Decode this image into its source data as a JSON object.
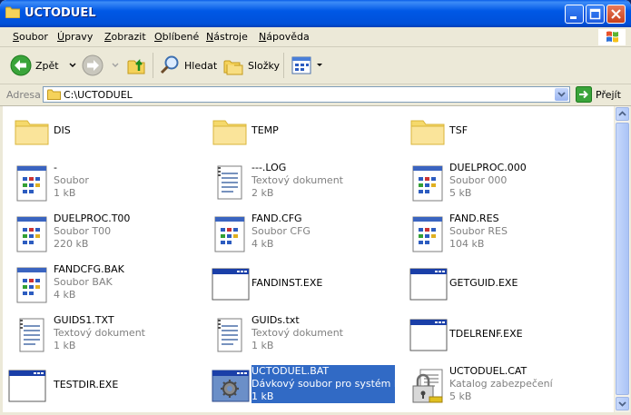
{
  "window": {
    "title": "UCTODUEL"
  },
  "menu": [
    {
      "key": "S",
      "rest": "oubor"
    },
    {
      "key": "Ú",
      "rest": "pravy"
    },
    {
      "key": "Z",
      "rest": "obrazit"
    },
    {
      "key": "O",
      "rest": "blíbené"
    },
    {
      "key": "N",
      "rest": "ástroje"
    },
    {
      "key": "N",
      "rest": "ápověda"
    }
  ],
  "toolbar": {
    "back_label": "Zpět",
    "search_label": "Hledat",
    "folders_label": "Složky"
  },
  "address": {
    "label": "Adresa",
    "path": "C:\\UCTODUEL",
    "go_label": "Přejít"
  },
  "items": [
    {
      "kind": "folder",
      "name": "DIS",
      "type": "",
      "size": ""
    },
    {
      "kind": "folder",
      "name": "TEMP",
      "type": "",
      "size": ""
    },
    {
      "kind": "folder",
      "name": "TSF",
      "type": "",
      "size": ""
    },
    {
      "kind": "file",
      "name": "-",
      "type": "Soubor",
      "size": "1 kB"
    },
    {
      "kind": "text",
      "name": "---.LOG",
      "type": "Textový dokument",
      "size": "2 kB"
    },
    {
      "kind": "file",
      "name": "DUELPROC.000",
      "type": "Soubor 000",
      "size": "5 kB"
    },
    {
      "kind": "file",
      "name": "DUELPROC.T00",
      "type": "Soubor T00",
      "size": "220 kB"
    },
    {
      "kind": "file",
      "name": "FAND.CFG",
      "type": "Soubor CFG",
      "size": "4 kB"
    },
    {
      "kind": "file",
      "name": "FAND.RES",
      "type": "Soubor RES",
      "size": "104 kB"
    },
    {
      "kind": "file",
      "name": "FANDCFG.BAK",
      "type": "Soubor BAK",
      "size": "4 kB"
    },
    {
      "kind": "exe",
      "name": "FANDINST.EXE",
      "type": "",
      "size": ""
    },
    {
      "kind": "exe",
      "name": "GETGUID.EXE",
      "type": "",
      "size": ""
    },
    {
      "kind": "text",
      "name": "GUIDS1.TXT",
      "type": "Textový dokument",
      "size": "1 kB"
    },
    {
      "kind": "text",
      "name": "GUIDs.txt",
      "type": "Textový dokument",
      "size": "1 kB"
    },
    {
      "kind": "exe",
      "name": "TDELRENF.EXE",
      "type": "",
      "size": ""
    },
    {
      "kind": "exe",
      "name": "TESTDIR.EXE",
      "type": "",
      "size": ""
    },
    {
      "kind": "bat",
      "name": "UCTODUEL.BAT",
      "type": "Dávkový soubor pro systém M...",
      "size": "1 kB",
      "selected": true
    },
    {
      "kind": "cat",
      "name": "UCTODUEL.CAT",
      "type": "Katalog zabezpečení",
      "size": "5 kB"
    }
  ]
}
